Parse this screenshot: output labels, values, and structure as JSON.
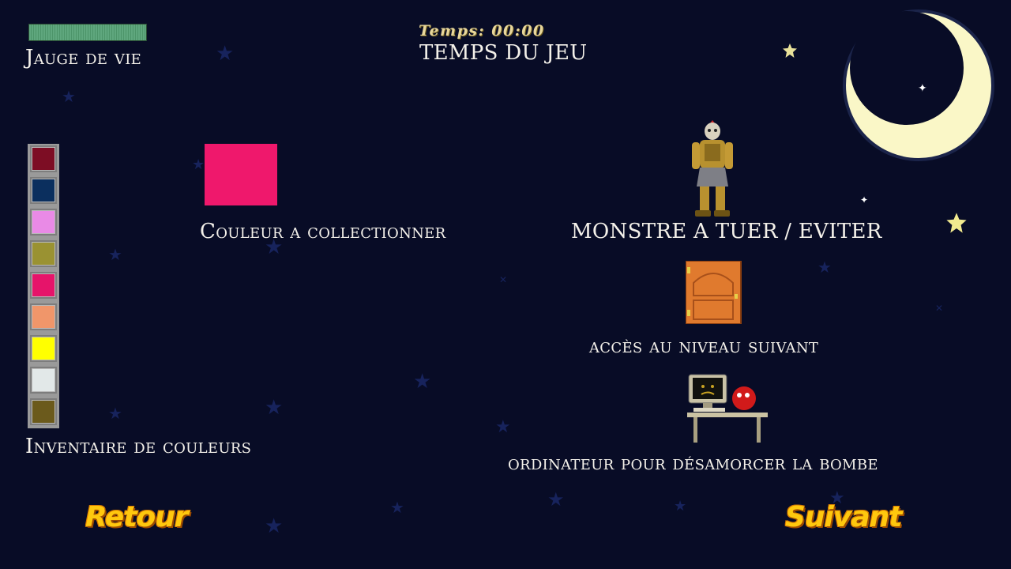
{
  "hud": {
    "health_label": "Jauge de vie",
    "health_fill": 1.0,
    "timer_text": "Temps: 00:00",
    "timer_label": "TEMPS DU JEU"
  },
  "legend": {
    "inventory_label": "Inventaire de couleurs",
    "color_label": "Couleur a collectionner",
    "monster_label": "MONSTRE A TUER / EVITER",
    "door_label": "accès au niveau suivant",
    "computer_label": "ordinateur pour désamorcer la bombe"
  },
  "inventory_colors": [
    "#7d0d24",
    "#0b2f5e",
    "#e98ae6",
    "#9a9232",
    "#e6146a",
    "#f0966a",
    "#ffff00",
    "#e2e8e8",
    "#6b5a1c"
  ],
  "collectible_color": "#ef186c",
  "nav": {
    "back_label": "Retour",
    "next_label": "Suivant"
  }
}
